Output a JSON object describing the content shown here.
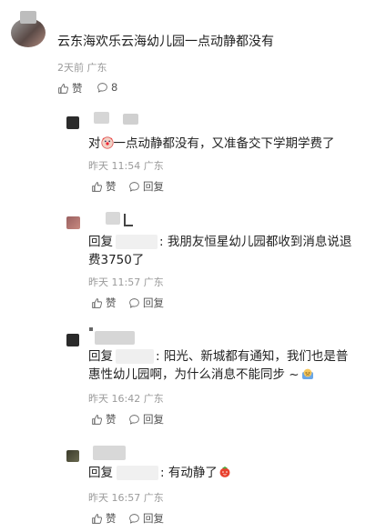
{
  "main_comment": {
    "text": "云东海欢乐云海幼儿园一点动静都没有",
    "time": "2天前",
    "location": "广东",
    "like_label": "赞",
    "reply_count": "8"
  },
  "replies": [
    {
      "text": "对",
      "text_after": "一点动静都没有，又准备交下学期学费了",
      "time": "昨天 11:54",
      "location": "广东",
      "like_label": "赞",
      "reply_label": "回复"
    },
    {
      "prefix": "回复",
      "line1": ": 我朋友恒星幼儿园都收到消息说退",
      "line2": "费3750了",
      "time": "昨天 11:57",
      "location": "广东",
      "like_label": "赞",
      "reply_label": "回复"
    },
    {
      "prefix": "回复",
      "line1": ": 阳光、新城都有通知，我们也是普",
      "line2": "惠性幼儿园啊，为什么消息不能同步 ~",
      "time": "昨天 16:42",
      "location": "广东",
      "like_label": "赞",
      "reply_label": "回复"
    },
    {
      "prefix": "回复",
      "line1": ": 有动静了",
      "time": "昨天 16:57",
      "location": "广东",
      "like_label": "赞",
      "reply_label": "回复"
    }
  ],
  "icons": {
    "like": "thumbs-up-icon",
    "comment": "comment-bubble-icon"
  },
  "colors": {
    "text": "#1f1f1f",
    "meta": "#9a9a9a",
    "action": "#555555"
  }
}
